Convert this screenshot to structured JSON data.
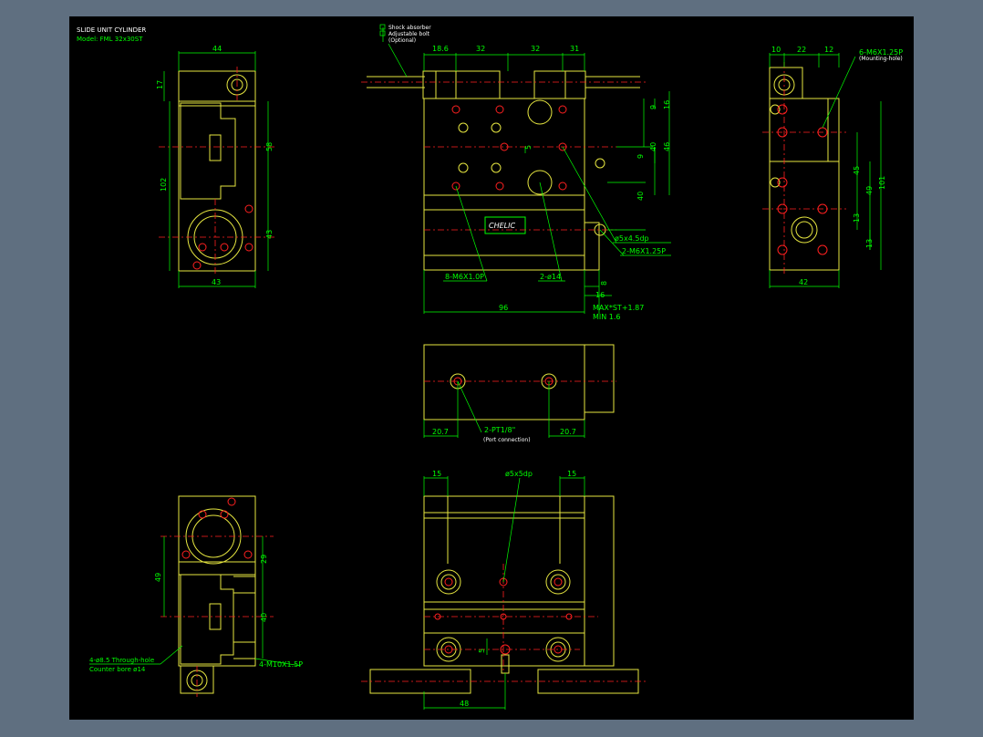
{
  "title_block": {
    "line1": "SLIDE UNIT CYLINDER",
    "line2": "Model: FML 32x30ST"
  },
  "notes": {
    "shock_absorber": "Shock absorber",
    "adjustable_bolt": "Adjustable bolt",
    "optional": "(Optional)",
    "nameplate": "CHELIC"
  },
  "dims": {
    "left_top_width": "44",
    "left_17": "17",
    "left_102": "102",
    "left_58": "58",
    "left_43v": "43",
    "left_bottom_width": "43",
    "top_18_6": "18.6",
    "top_32a": "32",
    "top_32b": "32",
    "top_31": "31",
    "right_9a": "9",
    "right_16": "16",
    "right_40a": "40",
    "right_46": "46",
    "right_9b": "9",
    "right_40b": "40",
    "dim_5": "5",
    "dim_8": "8",
    "dim_16b": "16",
    "dim_96": "96",
    "max_stroke": "MAX*ST+1.87",
    "min_val": "MIN   1.6",
    "call_m6x10": "8-M6X1.0P",
    "call_d14": "2-ø14",
    "call_d5": "ø5x4.5dp",
    "call_m6x125": "2-M6X1.25P",
    "side_10": "10",
    "side_22": "22",
    "side_12": "12",
    "side_mount": "6-M6X1.25P",
    "side_mount_sub": "(Mounting-hole)",
    "side_101": "101",
    "side_49": "49",
    "side_45": "45",
    "side_13a": "13",
    "side_13b": "13",
    "side_42": "42",
    "mid_20_7a": "20.7",
    "mid_20_7b": "20.7",
    "mid_port": "2-PT1/8\"",
    "mid_port_sub": "(Port connection)",
    "bot_15a": "15",
    "bot_15b": "15",
    "bot_d5": "ø5x5dp",
    "bot_5": "5",
    "bot_48": "48",
    "bl_49": "49",
    "bl_29": "29",
    "bl_40": "40",
    "bl_holes": "4-ø8.5  Through-hole",
    "bl_holes_sub": "Counter bore  ø14",
    "bl_m10": "4-M10X1.5P"
  }
}
